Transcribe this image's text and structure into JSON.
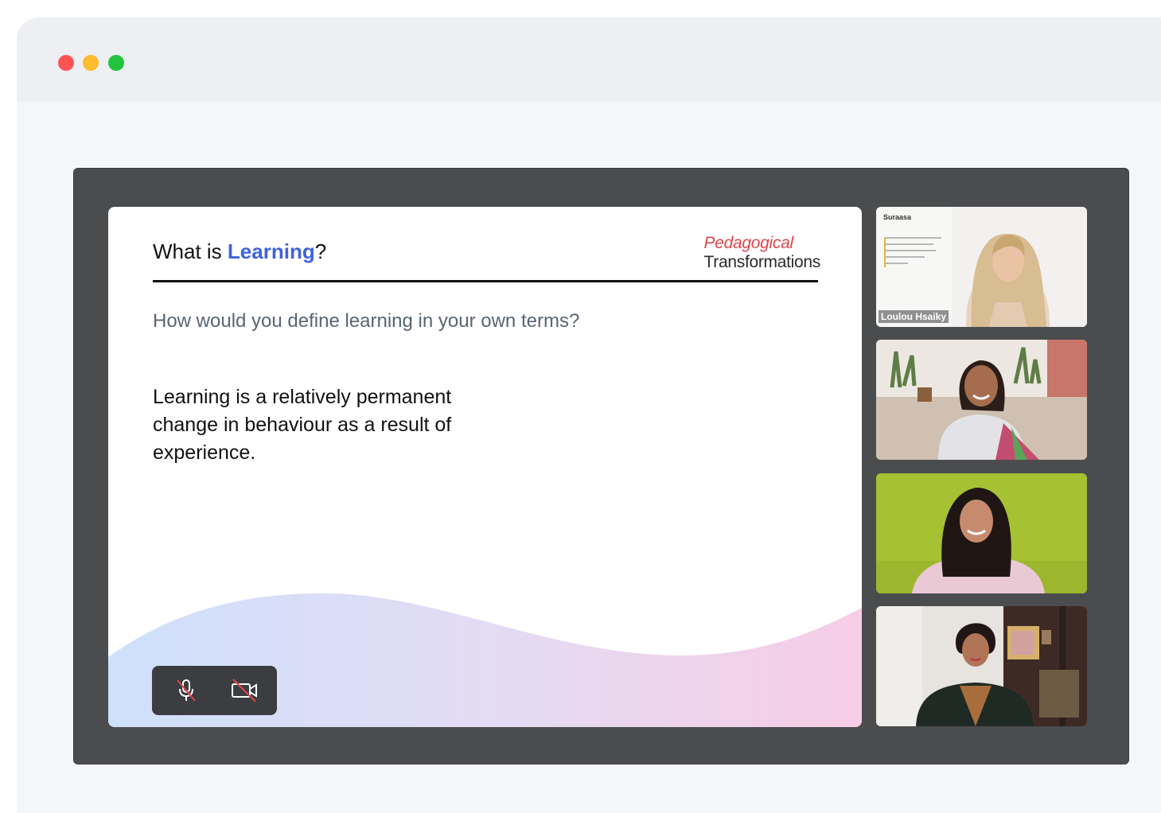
{
  "window": {
    "controls": [
      "close",
      "minimize",
      "maximize"
    ]
  },
  "slide": {
    "title_prefix": "What is ",
    "title_highlight": "Learning",
    "title_suffix": "?",
    "brand_top": "Pedagogical",
    "brand_bottom": "Transformations",
    "question": "How would you define learning in your own terms?",
    "answer": "Learning is a relatively permanent change in behaviour as a result of experience."
  },
  "controls": {
    "mic": "mic-off-icon",
    "camera": "camera-off-icon"
  },
  "participants": [
    {
      "name": "Loulou Hsaiky",
      "brand": "Suraasa"
    },
    {
      "name": ""
    },
    {
      "name": ""
    },
    {
      "name": ""
    }
  ],
  "colors": {
    "accent": "#3e63dd",
    "brand_red": "#e0444b",
    "meeting_bg": "#4b4c4e",
    "controls_bg": "#3b3d40",
    "mute_red": "#e0444b"
  }
}
